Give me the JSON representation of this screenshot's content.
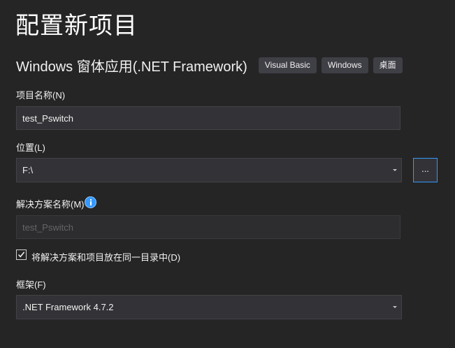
{
  "page": {
    "title": "配置新项目"
  },
  "template": {
    "name": "Windows 窗体应用(.NET Framework)",
    "tags": [
      "Visual Basic",
      "Windows",
      "桌面"
    ]
  },
  "project_name": {
    "label": "项目名称(N)",
    "value": "test_Pswitch"
  },
  "location": {
    "label": "位置(L)",
    "value": "F:\\",
    "browse_label": "..."
  },
  "solution_name": {
    "label": "解决方案名称(M)",
    "info_icon": "info-icon",
    "value": "test_Pswitch",
    "disabled": true
  },
  "same_directory": {
    "label": "将解决方案和项目放在同一目录中(D)",
    "checked": true
  },
  "framework": {
    "label": "框架(F)",
    "value": ".NET Framework 4.7.2"
  },
  "colors": {
    "background": "#252526",
    "field": "#333337",
    "tag": "#3f3f46",
    "accent": "#3399ff"
  }
}
